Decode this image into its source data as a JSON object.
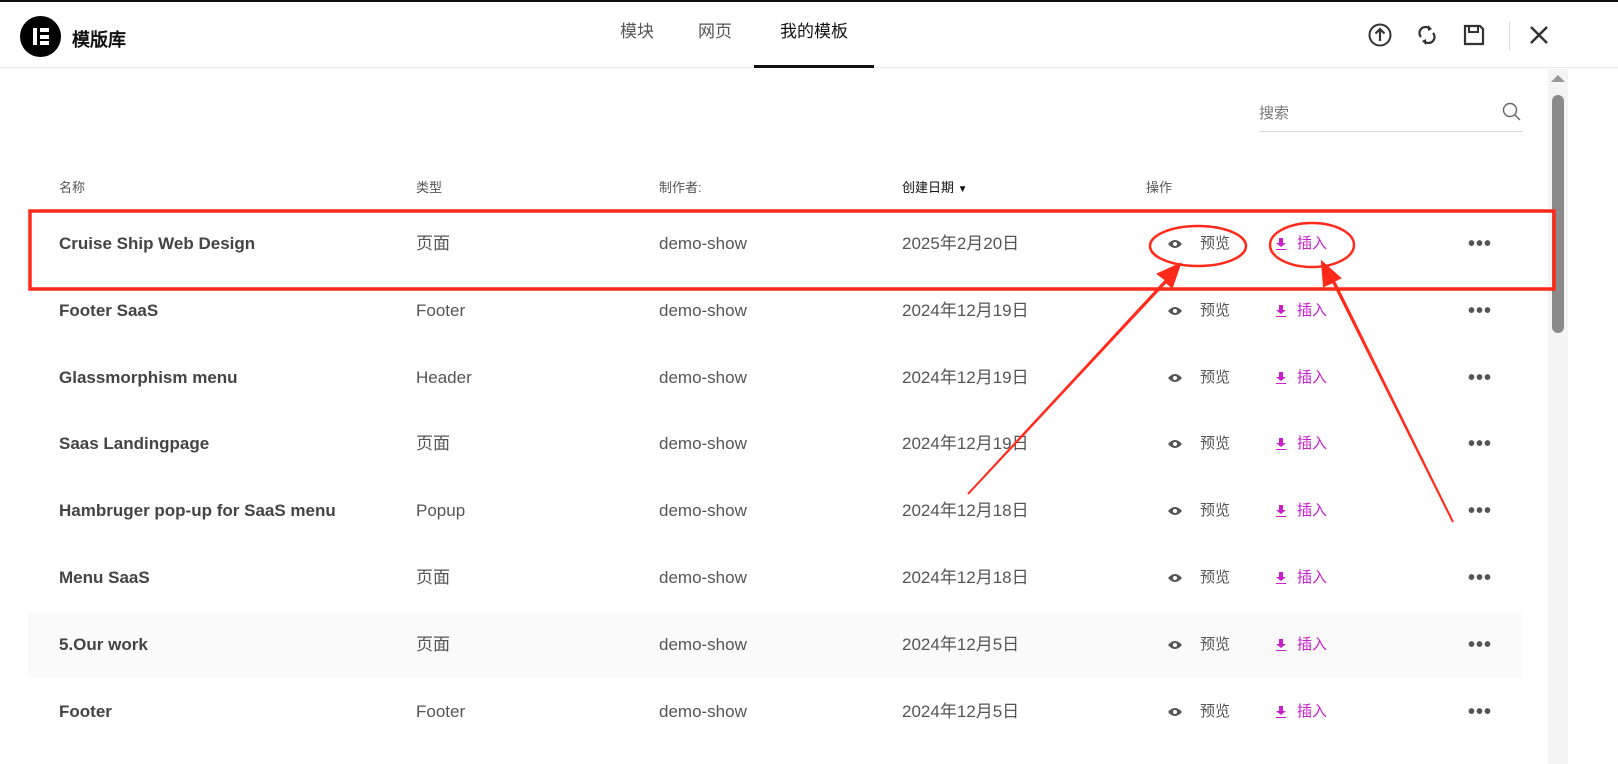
{
  "header": {
    "title": "模版库",
    "tabs": [
      "模块",
      "网页",
      "我的模板"
    ],
    "active_tab": 2
  },
  "search": {
    "placeholder": "搜索"
  },
  "columns": {
    "name": "名称",
    "type": "类型",
    "author": "制作者:",
    "date": "创建日期",
    "actions": "操作"
  },
  "actions": {
    "preview": "预览",
    "insert": "插入",
    "more": "•••"
  },
  "rows": [
    {
      "name": "Cruise Ship Web Design",
      "type": "页面",
      "author": "demo-show",
      "date": "2025年2月20日"
    },
    {
      "name": "Footer SaaS",
      "type": "Footer",
      "author": "demo-show",
      "date": "2024年12月19日"
    },
    {
      "name": "Glassmorphism menu",
      "type": "Header",
      "author": "demo-show",
      "date": "2024年12月19日"
    },
    {
      "name": "Saas Landingpage",
      "type": "页面",
      "author": "demo-show",
      "date": "2024年12月19日"
    },
    {
      "name": "Hambruger pop-up for SaaS menu",
      "type": "Popup",
      "author": "demo-show",
      "date": "2024年12月18日"
    },
    {
      "name": "Menu SaaS",
      "type": "页面",
      "author": "demo-show",
      "date": "2024年12月18日"
    },
    {
      "name": "5.Our work",
      "type": "页面",
      "author": "demo-show",
      "date": "2024年12月5日"
    },
    {
      "name": "Footer",
      "type": "Footer",
      "author": "demo-show",
      "date": "2024年12月5日"
    }
  ],
  "colors": {
    "insert": "#c81ecb",
    "annotation": "#ff2a1a"
  }
}
